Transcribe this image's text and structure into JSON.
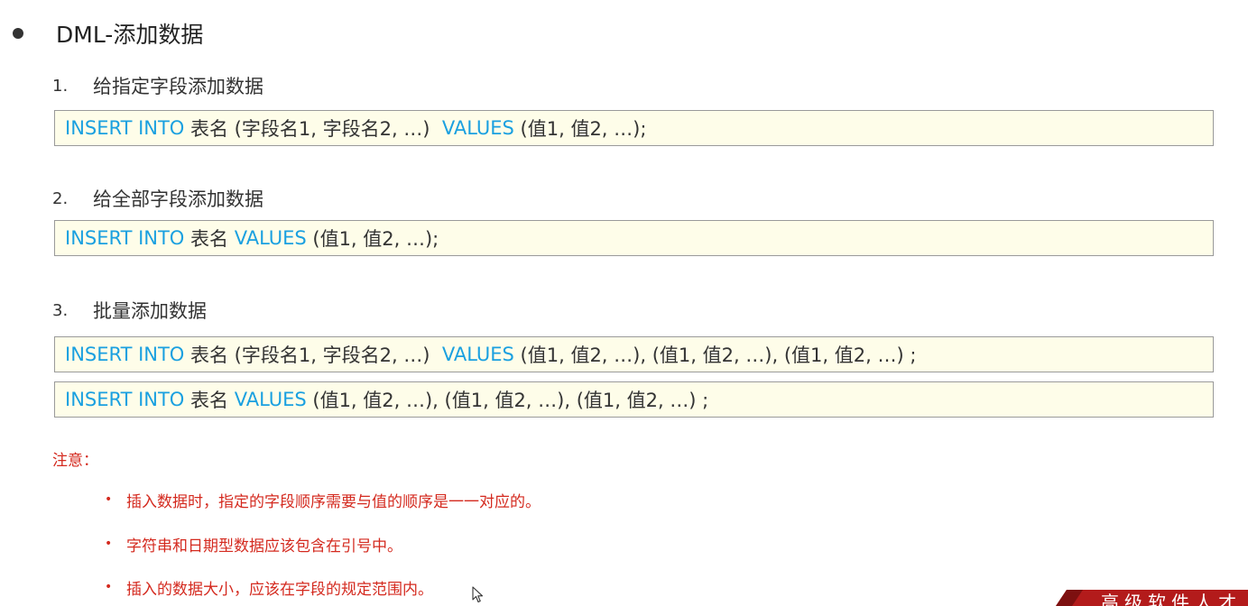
{
  "title": "DML-添加数据",
  "sections": [
    {
      "number": "1.",
      "heading": "给指定字段添加数据",
      "code": [
        {
          "kw1": "INSERT INTO",
          "t1": " 表名 (字段名1, 字段名2, …)  ",
          "kw2": "VALUES",
          "t2": " (值1, 值2, …);"
        }
      ]
    },
    {
      "number": "2.",
      "heading": "给全部字段添加数据",
      "code": [
        {
          "kw1": "INSERT INTO",
          "t1": " 表名 ",
          "kw2": "VALUES",
          "t2": " (值1, 值2, …);"
        }
      ]
    },
    {
      "number": "3.",
      "heading": "批量添加数据",
      "code": [
        {
          "kw1": "INSERT INTO",
          "t1": " 表名 (字段名1, 字段名2, …)  ",
          "kw2": "VALUES",
          "t2": " (值1, 值2, …), (值1, 值2, …), (值1, 值2, …) ;"
        },
        {
          "kw1": "INSERT INTO",
          "t1": " 表名 ",
          "kw2": "VALUES",
          "t2": " (值1, 值2, …), (值1, 值2, …), (值1, 值2, …) ;"
        }
      ]
    }
  ],
  "notes": {
    "label": "注意：",
    "bullet": "•",
    "items": [
      "插入数据时，指定的字段顺序需要与值的顺序是一一对应的。",
      "字符串和日期型数据应该包含在引号中。",
      "插入的数据大小，应该在字段的规定范围内。"
    ]
  },
  "banner": {
    "text": "高级软件人才",
    "color": "#b31b1b"
  },
  "colors": {
    "keyword": "#1aa0e0",
    "code_background": "#fefde9",
    "note": "#d42a1f"
  },
  "icons": {
    "cursor": "mouse-pointer-icon",
    "title_bullet": "bullet-dot-icon"
  }
}
